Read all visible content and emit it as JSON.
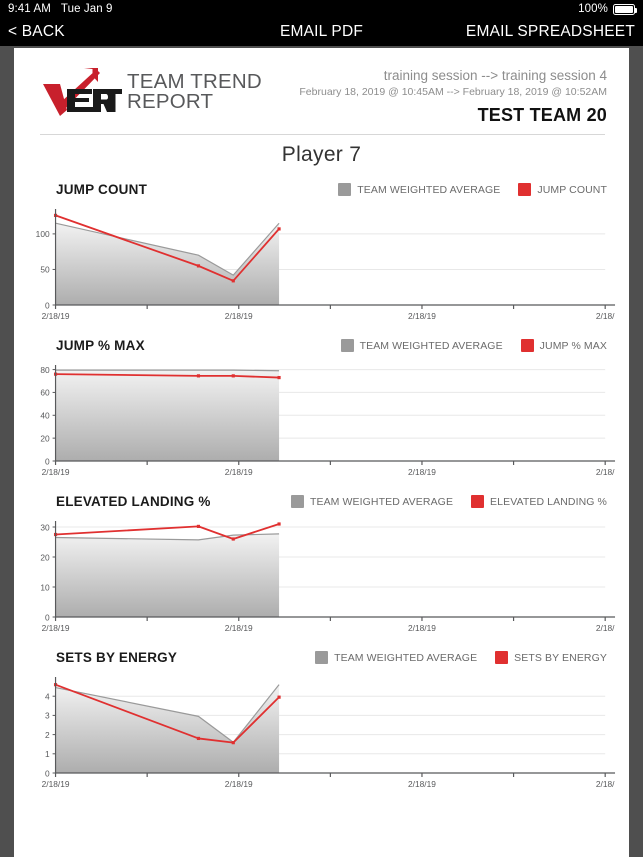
{
  "status_bar": {
    "time": "9:41 AM",
    "date": "Tue Jan 9",
    "battery_percent": "100%",
    "battery_icon": "battery-full-icon"
  },
  "nav_bar": {
    "back_label": "< BACK",
    "email_pdf_label": "EMAIL PDF",
    "email_spreadsheet_label": "EMAIL SPREADSHEET"
  },
  "report_header": {
    "logo_icon": "vert-logo-icon",
    "logo_word_line1": "TEAM TREND",
    "logo_word_line2": "REPORT",
    "session_range": "training session --> training session 4",
    "date_range": "February 18, 2019 @ 10:45AM --> February 18, 2019 @ 10:52AM",
    "team_name": "TEST TEAM 20",
    "player_title": "Player 7"
  },
  "colors": {
    "red": "#e03030",
    "gray": "#9a9a9a",
    "area_top": "#f2f2f2",
    "area_bottom": "#adadad",
    "axis": "#58595b",
    "grid": "#e8e8e8"
  },
  "legend_common": {
    "team_average_label": "TEAM WEIGHTED AVERAGE"
  },
  "chart_data": [
    {
      "type": "line",
      "title": "JUMP COUNT",
      "xlabel": "",
      "ylabel": "",
      "ylim": [
        0,
        135
      ],
      "yticks": [
        0,
        50,
        100
      ],
      "grid": true,
      "legend_position": "top-right",
      "x": [
        0,
        0.78,
        0.97,
        1.22
      ],
      "xticks": [
        0,
        0.5,
        1.0,
        1.5,
        2.0,
        2.5,
        3.0
      ],
      "xtick_labels": [
        "2/18/19",
        "",
        "2/18/19",
        "",
        "2/18/19",
        "",
        "2/18/"
      ],
      "series": [
        {
          "name": "TEAM WEIGHTED AVERAGE",
          "color": "#9a9a9a",
          "values": [
            115,
            70,
            42,
            115
          ]
        },
        {
          "name": "JUMP COUNT",
          "color": "#e03030",
          "values": [
            126,
            55,
            34,
            107
          ]
        }
      ]
    },
    {
      "type": "line",
      "title": "JUMP % MAX",
      "xlabel": "",
      "ylabel": "",
      "ylim": [
        0,
        84
      ],
      "yticks": [
        0,
        20,
        40,
        60,
        80
      ],
      "grid": true,
      "legend_position": "top-right",
      "x": [
        0,
        0.78,
        0.97,
        1.22
      ],
      "xticks": [
        0,
        0.5,
        1.0,
        1.5,
        2.0,
        2.5,
        3.0
      ],
      "xtick_labels": [
        "2/18/19",
        "",
        "2/18/19",
        "",
        "2/18/19",
        "",
        "2/18/"
      ],
      "series": [
        {
          "name": "TEAM WEIGHTED AVERAGE",
          "color": "#9a9a9a",
          "values": [
            79.5,
            79.5,
            79.5,
            79.0
          ]
        },
        {
          "name": "JUMP % MAX",
          "color": "#e03030",
          "values": [
            76,
            74.5,
            74.5,
            73
          ]
        }
      ]
    },
    {
      "type": "line",
      "title": "ELEVATED LANDING %",
      "xlabel": "",
      "ylabel": "",
      "ylim": [
        0,
        32
      ],
      "yticks": [
        0,
        10,
        20,
        30
      ],
      "grid": true,
      "legend_position": "top-right",
      "x": [
        0,
        0.78,
        0.97,
        1.22
      ],
      "xticks": [
        0,
        0.5,
        1.0,
        1.5,
        2.0,
        2.5,
        3.0
      ],
      "xtick_labels": [
        "2/18/19",
        "",
        "2/18/19",
        "",
        "2/18/19",
        "",
        "2/18/"
      ],
      "series": [
        {
          "name": "TEAM WEIGHTED AVERAGE",
          "color": "#9a9a9a",
          "values": [
            26.5,
            25.7,
            27.3,
            27.7
          ]
        },
        {
          "name": "ELEVATED LANDING %",
          "color": "#e03030",
          "values": [
            27.5,
            30.2,
            26.0,
            31.0
          ]
        }
      ]
    },
    {
      "type": "line",
      "title": "SETS BY ENERGY",
      "xlabel": "",
      "ylabel": "",
      "ylim": [
        0,
        5
      ],
      "yticks": [
        0,
        1,
        2,
        3,
        4
      ],
      "grid": true,
      "legend_position": "top-right",
      "x": [
        0,
        0.78,
        0.97,
        1.22
      ],
      "xticks": [
        0,
        0.5,
        1.0,
        1.5,
        2.0,
        2.5,
        3.0
      ],
      "xtick_labels": [
        "2/18/19",
        "",
        "2/18/19",
        "",
        "2/18/19",
        "",
        "2/18/"
      ],
      "series": [
        {
          "name": "TEAM WEIGHTED AVERAGE",
          "color": "#9a9a9a",
          "values": [
            4.45,
            2.95,
            1.6,
            4.6
          ]
        },
        {
          "name": "SETS BY ENERGY",
          "color": "#e03030",
          "values": [
            4.6,
            1.8,
            1.58,
            3.95
          ]
        }
      ]
    }
  ]
}
